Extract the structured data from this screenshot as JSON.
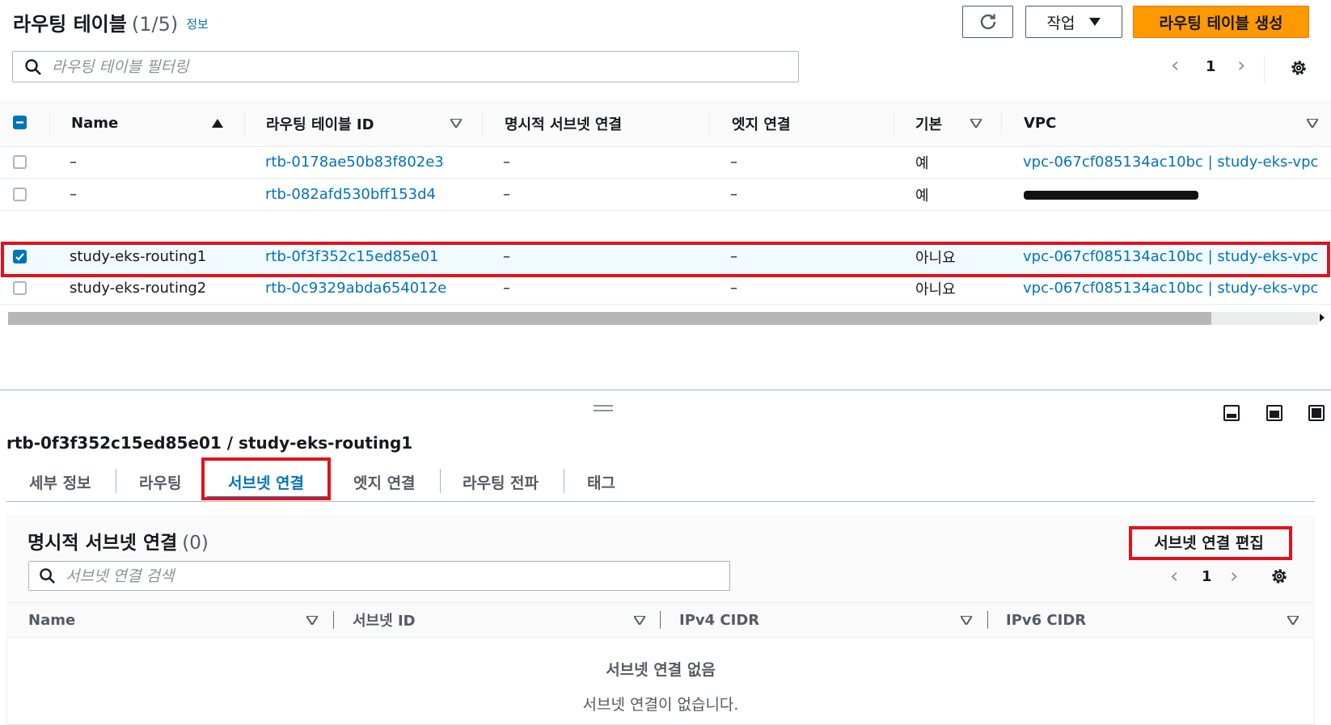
{
  "header": {
    "title": "라우팅 테이블",
    "count": "(1/5)",
    "info_link": "정보",
    "actions_label": "작업",
    "create_label": "라우팅 테이블 생성"
  },
  "filter": {
    "placeholder": "라우팅 테이블 필터링"
  },
  "pagination": {
    "page": "1"
  },
  "table": {
    "columns": [
      "Name",
      "라우팅 테이블 ID",
      "명시적 서브넷 연결",
      "엣지 연결",
      "기본",
      "VPC"
    ],
    "rows": [
      {
        "name": "–",
        "id": "rtb-0178ae50b83f802e3",
        "subnet": "–",
        "edge": "–",
        "main": "예",
        "vpc": "vpc-067cf085134ac10bc | study-eks-vpc",
        "selected": false
      },
      {
        "name": "–",
        "id": "rtb-082afd530bff153d4",
        "subnet": "–",
        "edge": "–",
        "main": "예",
        "vpc": "",
        "selected": false
      },
      {
        "name": "study-eks-routing1",
        "id": "rtb-0f3f352c15ed85e01",
        "subnet": "–",
        "edge": "–",
        "main": "아니요",
        "vpc": "vpc-067cf085134ac10bc | study-eks-vpc",
        "selected": true
      },
      {
        "name": "study-eks-routing2",
        "id": "rtb-0c9329abda654012e",
        "subnet": "–",
        "edge": "–",
        "main": "아니요",
        "vpc": "vpc-067cf085134ac10bc | study-eks-vpc",
        "selected": false
      }
    ]
  },
  "detail": {
    "title": "rtb-0f3f352c15ed85e01 / study-eks-routing1",
    "tabs": [
      "세부 정보",
      "라우팅",
      "서브넷 연결",
      "엣지 연결",
      "라우팅 전파",
      "태그"
    ],
    "active_tab": "서브넷 연결"
  },
  "subnet_assoc": {
    "title": "명시적 서브넷 연결",
    "count": "(0)",
    "edit_label": "서브넷 연결 편집",
    "search_placeholder": "서브넷 연결 검색",
    "page": "1",
    "columns": [
      "Name",
      "서브넷 ID",
      "IPv4 CIDR",
      "IPv6 CIDR"
    ],
    "empty_title": "서브넷 연결 없음",
    "empty_desc": "서브넷 연결이 없습니다."
  },
  "colors": {
    "primary": "#ff9900",
    "link": "#0073bb",
    "highlight": "#e0121c",
    "text": "#16191f",
    "secondary_text": "#545b64"
  }
}
